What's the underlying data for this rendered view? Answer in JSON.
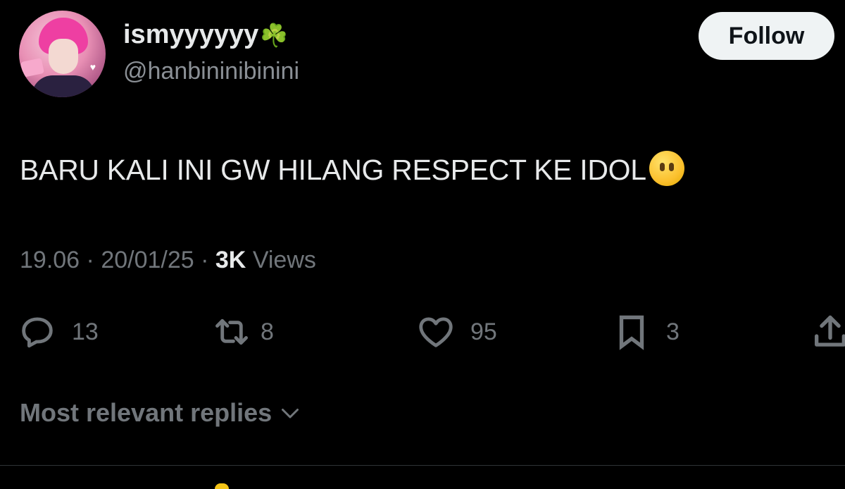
{
  "author": {
    "display_name": "ismyyyyyy",
    "name_emoji": "☘️",
    "handle": "@hanbininibinini"
  },
  "follow_label": "Follow",
  "tweet": {
    "text": "BARU KALI INI GW HILANG RESPECT KE IDOL",
    "emoji_icon": "face-without-mouth-emoji"
  },
  "meta": {
    "time": "19.06",
    "separator": " · ",
    "date": "20/01/25",
    "views_count": "3K",
    "views_label": "Views"
  },
  "actions": {
    "replies": "13",
    "reposts": "8",
    "likes": "95",
    "bookmarks": "3"
  },
  "sort_label": "Most relevant replies",
  "colors": {
    "background": "#000000",
    "text_primary": "#e7e9ea",
    "text_secondary": "#71767b",
    "follow_bg": "#eff3f4"
  },
  "icons": [
    "reply-icon",
    "repost-icon",
    "like-icon",
    "bookmark-icon",
    "share-icon",
    "chevron-down-icon"
  ]
}
